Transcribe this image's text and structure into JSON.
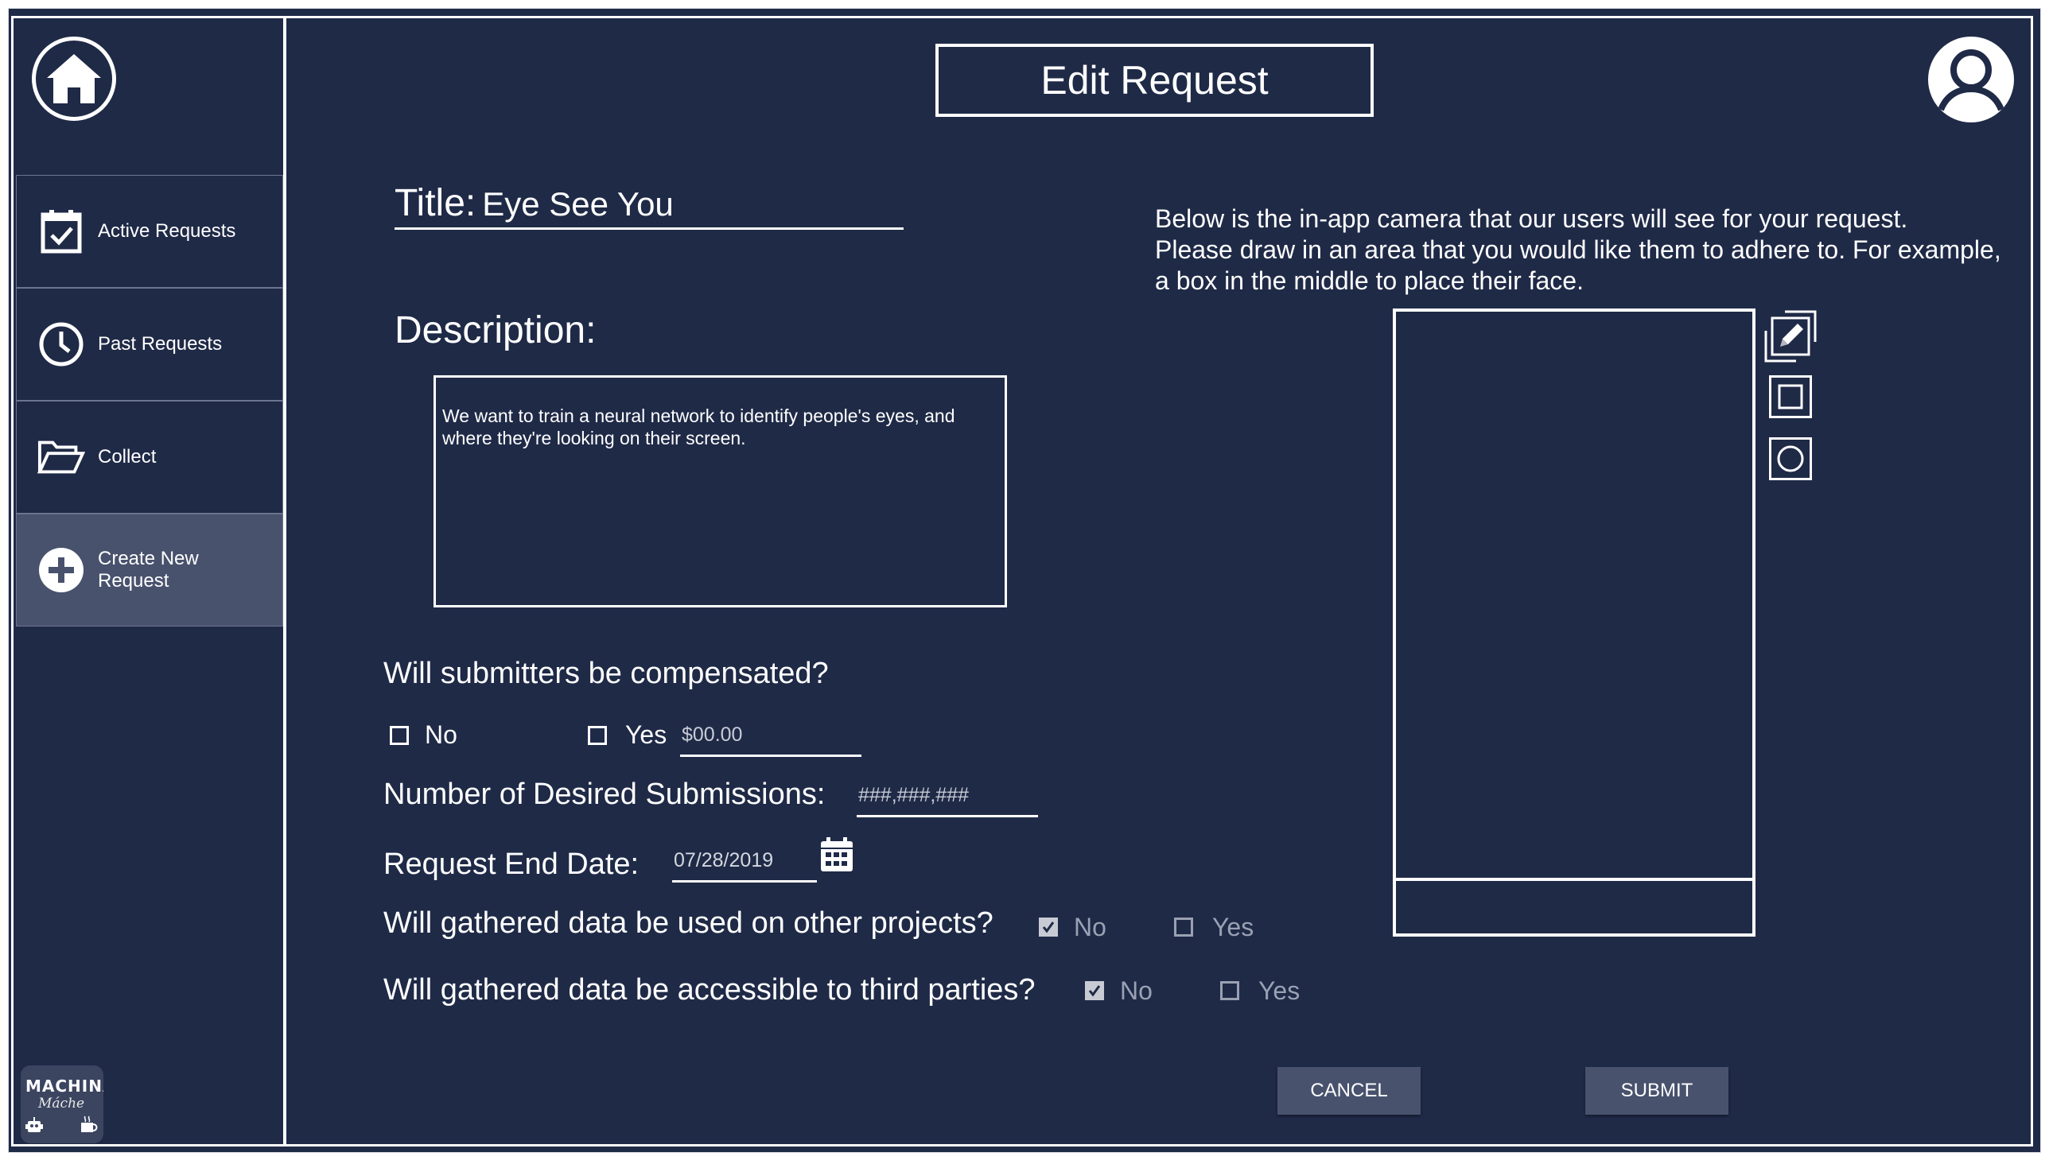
{
  "header": {
    "title": "Edit Request"
  },
  "sidebar": {
    "items": [
      {
        "label": "Active Requests",
        "icon": "calendar-check-icon"
      },
      {
        "label": "Past Requests",
        "icon": "clock-icon"
      },
      {
        "label": "Collect",
        "icon": "folder-open-icon"
      },
      {
        "label": "Create New Request",
        "icon": "plus-circle-icon",
        "active": true
      }
    ],
    "logo": {
      "line1": "MACHINA",
      "line2": "Máche"
    }
  },
  "form": {
    "title_label": "Title:",
    "title_value": "Eye See You",
    "description_label": "Description:",
    "description_value": "We want to train a neural network to identify people's eyes, and where they're looking on their screen.",
    "compensation": {
      "question": "Will submitters be compensated?",
      "no_label": "No",
      "no_checked": false,
      "yes_label": "Yes",
      "yes_checked": false,
      "amount_placeholder": "$00.00"
    },
    "submissions": {
      "label": "Number of Desired Submissions:",
      "placeholder": "###,###,###"
    },
    "end_date": {
      "label": "Request End Date:",
      "value": "07/28/2019"
    },
    "other_projects": {
      "question": "Will gathered data be used on other projects?",
      "no_label": "No",
      "no_checked": true,
      "yes_label": "Yes",
      "yes_checked": false
    },
    "third_parties": {
      "question": "Will gathered data be accessible to third parties?",
      "no_label": "No",
      "no_checked": true,
      "yes_label": "Yes",
      "yes_checked": false
    }
  },
  "camera": {
    "instructions_line1": "Below is the in-app camera that our users will see for your request.",
    "instructions_line2": "Please draw in an area that you would like them to adhere to. For example,",
    "instructions_line3": "a box in the middle to place their face.",
    "tools": [
      "pencil-icon",
      "square-icon",
      "circle-icon"
    ]
  },
  "actions": {
    "cancel_label": "CANCEL",
    "submit_label": "SUBMIT"
  },
  "colors": {
    "background": "#1f2a47",
    "active_item": "#48526d",
    "border": "#ffffff"
  }
}
